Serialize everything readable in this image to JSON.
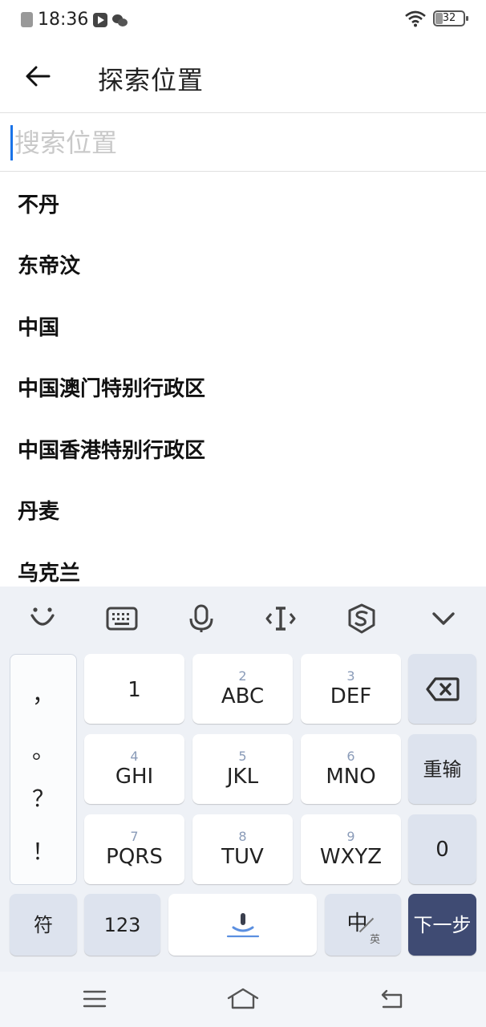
{
  "status_bar": {
    "time": "18:36",
    "battery": "32",
    "icons": [
      "notification-icon",
      "video-app-icon",
      "wechat-icon",
      "wifi-icon",
      "battery-icon"
    ]
  },
  "header": {
    "title": "探索位置",
    "back_icon": "arrow-left-icon"
  },
  "search": {
    "placeholder": "搜索位置",
    "value": ""
  },
  "locations": [
    "不丹",
    "东帝汶",
    "中国",
    "中国澳门特别行政区",
    "中国香港特别行政区",
    "丹麦",
    "乌克兰"
  ],
  "keyboard": {
    "toolbar_icons": [
      "emoji-icon",
      "keyboard-icon",
      "microphone-icon",
      "cursor-icon",
      "sogou-logo-icon",
      "chevron-down-icon"
    ],
    "punctuation": [
      "，",
      "。",
      "？",
      "！"
    ],
    "keys": [
      {
        "num": "",
        "label": "1"
      },
      {
        "num": "2",
        "label": "ABC"
      },
      {
        "num": "3",
        "label": "DEF"
      },
      {
        "num": "4",
        "label": "GHI"
      },
      {
        "num": "5",
        "label": "JKL"
      },
      {
        "num": "6",
        "label": "MNO"
      },
      {
        "num": "7",
        "label": "PQRS"
      },
      {
        "num": "8",
        "label": "TUV"
      },
      {
        "num": "9",
        "label": "WXYZ"
      }
    ],
    "backspace_icon": "backspace-icon",
    "reinput_label": "重输",
    "zero_label": "0",
    "symbol_label": "符",
    "numeric_label": "123",
    "space_icon": "microphone-space-icon",
    "lang_main": "中",
    "lang_sub": "英",
    "next_label": "下一步",
    "accent_color": "#3f4b73"
  },
  "nav_bar": {
    "icons": [
      "menu-icon",
      "home-icon",
      "back-icon"
    ]
  }
}
